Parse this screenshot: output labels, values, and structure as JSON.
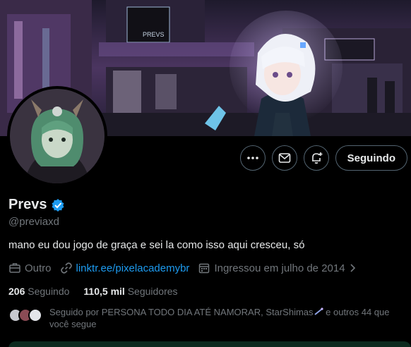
{
  "profile": {
    "display_name": "Prevs",
    "handle": "@previaxd",
    "bio": "mano eu dou jogo de graça e sei la como isso aqui cresceu, só",
    "verified_icon": "verified-badge-icon"
  },
  "actions": {
    "more_icon": "more-icon",
    "message_icon": "mail-icon",
    "notify_icon": "bell-plus-icon",
    "follow_label": "Seguindo"
  },
  "meta": {
    "category": "Outro",
    "link": "linktr.ee/pixelacademybr",
    "joined": "Ingressou em julho de 2014"
  },
  "stats": {
    "following_count": "206",
    "following_label": "Seguindo",
    "followers_count": "110,5 mil",
    "followers_label": "Seguidores"
  },
  "followed_by": {
    "text_line1": "Seguido por PERSONA TODO DIA ATÉ NAMORAR, StarShimas",
    "text_line1b": " e outros 44 que",
    "text_line2": "você segue"
  },
  "colors": {
    "accent": "#1d9bf0",
    "muted": "#71767b",
    "text": "#e7e9ea",
    "border": "#536471"
  }
}
